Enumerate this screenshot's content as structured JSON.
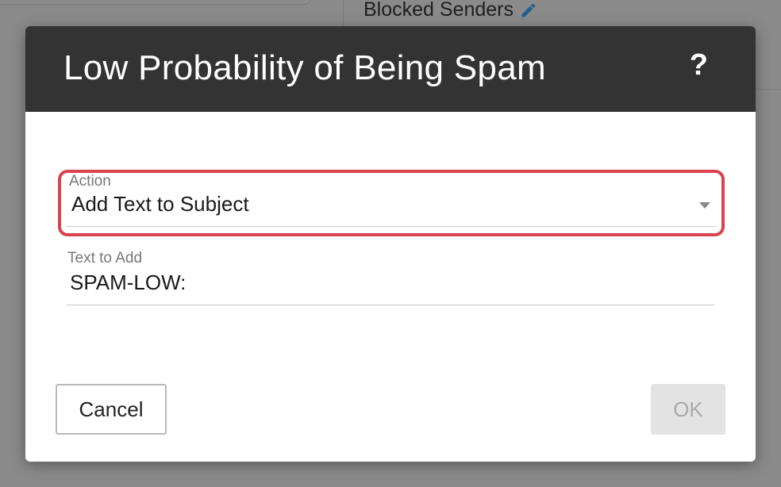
{
  "background": {
    "blocked_senders_label": "Blocked Senders",
    "edit_icon": "pencil-icon",
    "accent_color": "#1f5f8b"
  },
  "dialog": {
    "title": "Low Probability of Being Spam",
    "help_label": "?",
    "action": {
      "label": "Action",
      "value": "Add Text to Subject",
      "highlight_color": "#d9444f"
    },
    "text_to_add": {
      "label": "Text to Add",
      "value": "SPAM-LOW:"
    },
    "buttons": {
      "cancel_label": "Cancel",
      "ok_label": "OK"
    }
  }
}
